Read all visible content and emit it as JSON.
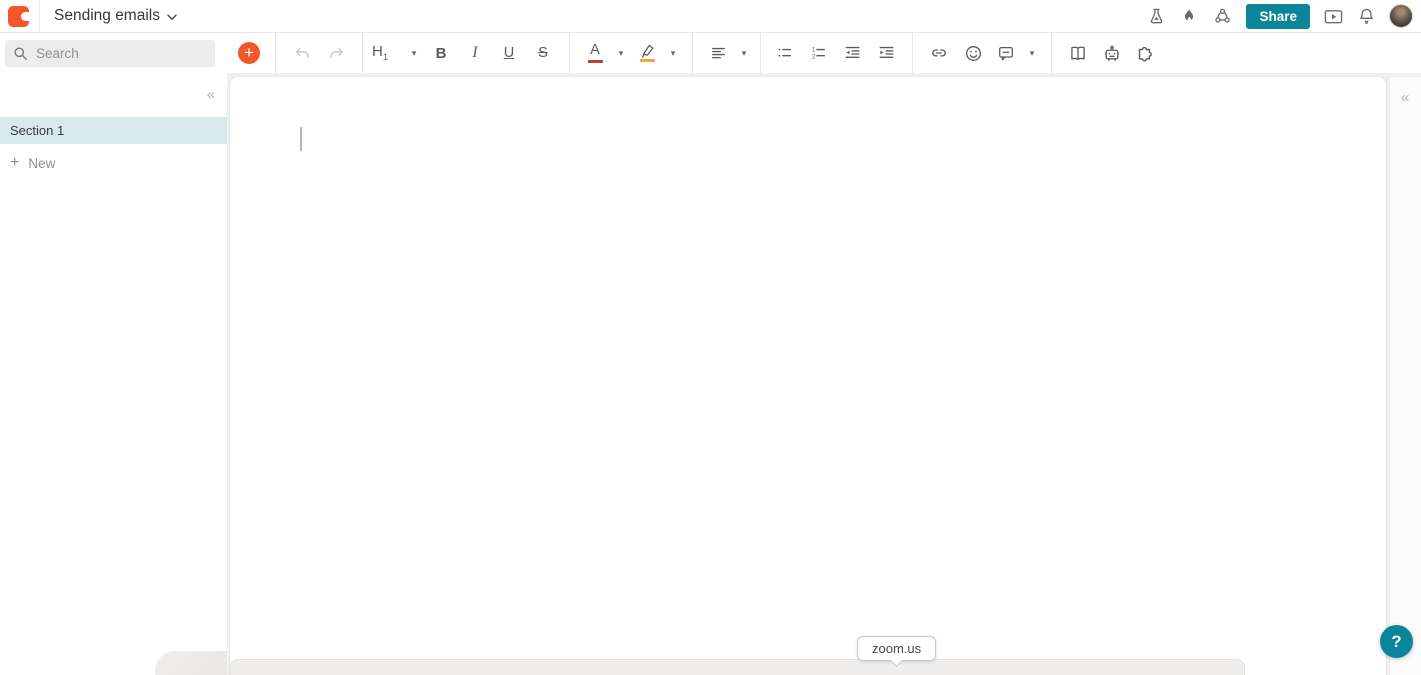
{
  "header": {
    "title": "Sending emails",
    "share_button": "Share"
  },
  "toolbar": {
    "heading": "H",
    "heading_sub": "1",
    "bold": "B",
    "italic": "I",
    "underline": "U",
    "strikethrough": "S",
    "text_color": "A"
  },
  "sidebar": {
    "search_placeholder": "Search",
    "items": [
      {
        "label": "Section 1",
        "selected": true
      }
    ],
    "new_button": "New"
  },
  "canvas": {
    "link_tooltip": "zoom.us"
  },
  "help_button": "?",
  "icons": {
    "plus": "+",
    "caret_down": "▾",
    "collapse_chevrons": "«"
  },
  "colors": {
    "brand_red": "#f2572c",
    "accent_teal": "#0b8599",
    "selected_section_bg": "#d6e9ed",
    "text_color_swatch": "#c43c2e",
    "highlight_swatch": "#eda73c",
    "canvas_bg": "#ffffff",
    "workspace_bg": "#f1f0ee"
  }
}
